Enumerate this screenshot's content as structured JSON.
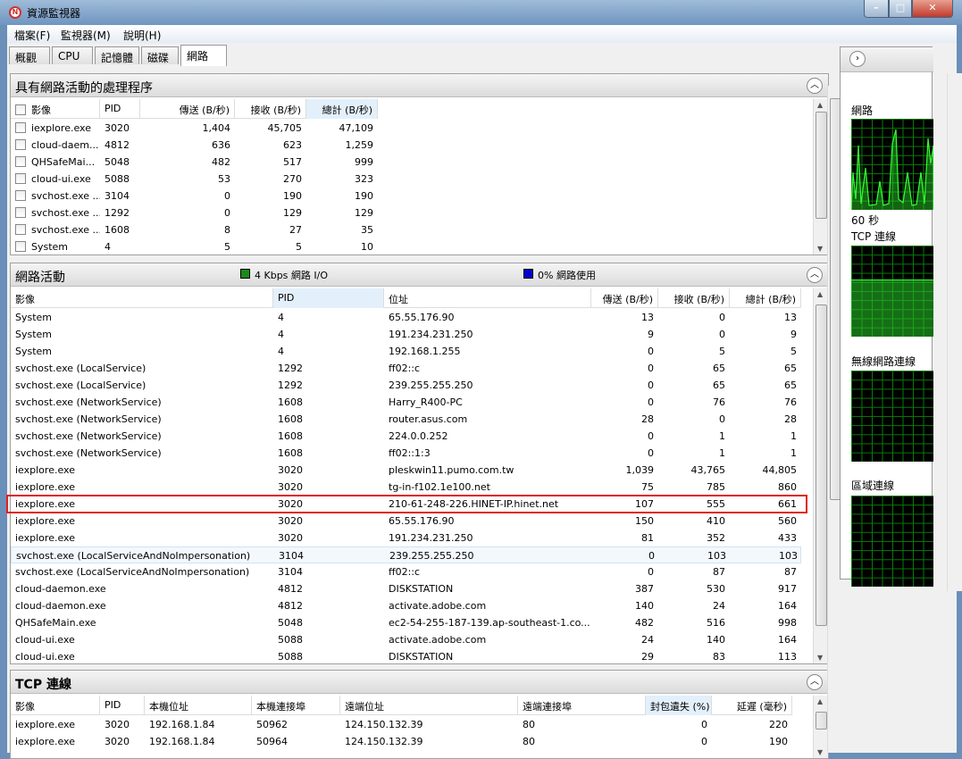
{
  "window": {
    "title": "資源監視器",
    "icon": "resource-monitor-icon",
    "controls": [
      "minimize",
      "maximize",
      "close"
    ]
  },
  "menu": [
    "檔案(F)",
    "監視器(M)",
    "說明(H)"
  ],
  "tabs": [
    "概觀",
    "CPU",
    "記憶體",
    "磁碟",
    "網路"
  ],
  "active_tab": "網路",
  "processes": {
    "title": "具有網路活動的處理程序",
    "columns": [
      "影像",
      "PID",
      "傳送 (B/秒)",
      "接收 (B/秒)",
      "總計 (B/秒)"
    ],
    "sorted_column": "總計 (B/秒)",
    "rows": [
      [
        "iexplore.exe",
        "3020",
        "1,404",
        "45,705",
        "47,109"
      ],
      [
        "cloud-daem...",
        "4812",
        "636",
        "623",
        "1,259"
      ],
      [
        "QHSafeMai...",
        "5048",
        "482",
        "517",
        "999"
      ],
      [
        "cloud-ui.exe",
        "5088",
        "53",
        "270",
        "323"
      ],
      [
        "svchost.exe ...",
        "3104",
        "0",
        "190",
        "190"
      ],
      [
        "svchost.exe ...",
        "1292",
        "0",
        "129",
        "129"
      ],
      [
        "svchost.exe ...",
        "1608",
        "8",
        "27",
        "35"
      ],
      [
        "System",
        "4",
        "5",
        "5",
        "10"
      ]
    ]
  },
  "activity": {
    "title": "網路活動",
    "io_legend": "4 Kbps 網路 I/O",
    "usage_legend": "0% 網路使用",
    "io_color": "#1a8a1a",
    "usage_color": "#0000cc",
    "columns": [
      "影像",
      "PID",
      "位址",
      "傳送 (B/秒)",
      "接收 (B/秒)",
      "總計 (B/秒)"
    ],
    "sorted_column": "PID",
    "highlighted_row": 11,
    "rows": [
      [
        "System",
        "4",
        "65.55.176.90",
        "13",
        "0",
        "13"
      ],
      [
        "System",
        "4",
        "191.234.231.250",
        "9",
        "0",
        "9"
      ],
      [
        "System",
        "4",
        "192.168.1.255",
        "0",
        "5",
        "5"
      ],
      [
        "svchost.exe (LocalService)",
        "1292",
        "ff02::c",
        "0",
        "65",
        "65"
      ],
      [
        "svchost.exe (LocalService)",
        "1292",
        "239.255.255.250",
        "0",
        "65",
        "65"
      ],
      [
        "svchost.exe (NetworkService)",
        "1608",
        "Harry_R400-PC",
        "0",
        "76",
        "76"
      ],
      [
        "svchost.exe (NetworkService)",
        "1608",
        "router.asus.com",
        "28",
        "0",
        "28"
      ],
      [
        "svchost.exe (NetworkService)",
        "1608",
        "224.0.0.252",
        "0",
        "1",
        "1"
      ],
      [
        "svchost.exe (NetworkService)",
        "1608",
        "ff02::1:3",
        "0",
        "1",
        "1"
      ],
      [
        "iexplore.exe",
        "3020",
        "pleskwin11.pumo.com.tw",
        "1,039",
        "43,765",
        "44,805"
      ],
      [
        "iexplore.exe",
        "3020",
        "tg-in-f102.1e100.net",
        "75",
        "785",
        "860"
      ],
      [
        "iexplore.exe",
        "3020",
        "210-61-248-226.HINET-IP.hinet.net",
        "107",
        "555",
        "661"
      ],
      [
        "iexplore.exe",
        "3020",
        "65.55.176.90",
        "150",
        "410",
        "560"
      ],
      [
        "iexplore.exe",
        "3020",
        "191.234.231.250",
        "81",
        "352",
        "433"
      ],
      [
        "svchost.exe (LocalServiceAndNoImpersonation)",
        "3104",
        "239.255.255.250",
        "0",
        "103",
        "103"
      ],
      [
        "svchost.exe (LocalServiceAndNoImpersonation)",
        "3104",
        "ff02::c",
        "0",
        "87",
        "87"
      ],
      [
        "cloud-daemon.exe",
        "4812",
        "DISKSTATION",
        "387",
        "530",
        "917"
      ],
      [
        "cloud-daemon.exe",
        "4812",
        "activate.adobe.com",
        "140",
        "24",
        "164"
      ],
      [
        "QHSafeMain.exe",
        "5048",
        "ec2-54-255-187-139.ap-southeast-1.co...",
        "482",
        "516",
        "998"
      ],
      [
        "cloud-ui.exe",
        "5088",
        "activate.adobe.com",
        "24",
        "140",
        "164"
      ],
      [
        "cloud-ui.exe",
        "5088",
        "DISKSTATION",
        "29",
        "83",
        "113"
      ]
    ]
  },
  "tcp": {
    "title": "TCP 連線",
    "columns": [
      "影像",
      "PID",
      "本機位址",
      "本機連接埠",
      "遠端位址",
      "遠端連接埠",
      "封包遺失 (%)",
      "延遲 (毫秒)"
    ],
    "sorted_column": "封包遺失 (%)",
    "rows": [
      [
        "iexplore.exe",
        "3020",
        "192.168.1.84",
        "50962",
        "124.150.132.39",
        "80",
        "0",
        "220"
      ],
      [
        "iexplore.exe",
        "3020",
        "192.168.1.84",
        "50964",
        "124.150.132.39",
        "80",
        "0",
        "190"
      ]
    ]
  },
  "side": {
    "graphs": [
      "網路",
      "TCP 連線",
      "無線網路連線",
      "區域連線"
    ],
    "time_label": "60 秒"
  }
}
